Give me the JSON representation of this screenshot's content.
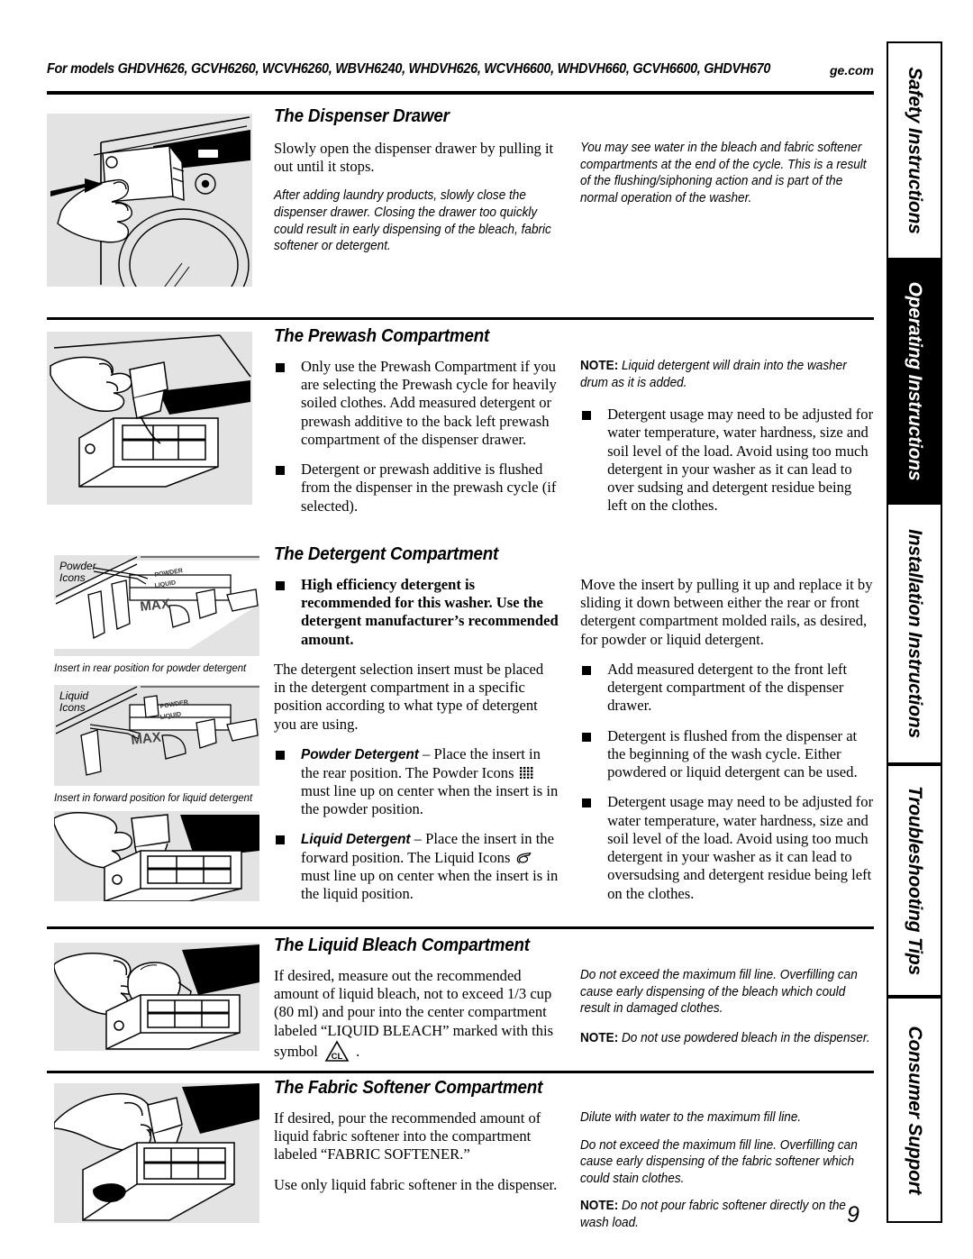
{
  "header": {
    "models": "For models GHDVH626, GCVH6260, WCVH6260, WBVH6240, WHDVH626, WCVH6600, WHDVH660, GCVH6600, GHDVH670",
    "site": "ge.com"
  },
  "page_number": "9",
  "sidebar": {
    "tabs": [
      {
        "label": "Safety Instructions",
        "active": false
      },
      {
        "label": "Operating Instructions",
        "active": true
      },
      {
        "label": "Installation Instructions",
        "active": false
      },
      {
        "label": "Troubleshooting Tips",
        "active": false
      },
      {
        "label": "Consumer Support",
        "active": false
      }
    ]
  },
  "sections": {
    "dispenser_drawer": {
      "title": "The Dispenser Drawer",
      "left_p1": "Slowly open the dispenser drawer by pulling it out until it stops.",
      "left_p2": "After adding laundry products, slowly close the dispenser drawer. Closing the drawer too quickly could result in early dispensing of the bleach, fabric softener or detergent.",
      "right_p1": "You may see water in the bleach and fabric softener compartments at the end of the cycle. This is a result of the flushing/siphoning action and is part of the normal operation of the washer."
    },
    "prewash": {
      "title": "The Prewash Compartment",
      "bullets": [
        "Only use the Prewash Compartment if you are selecting the Prewash cycle for heavily soiled clothes. Add measured detergent or prewash additive to the back left prewash compartment of the dispenser drawer.",
        "Detergent or prewash additive is flushed from the dispenser in the prewash cycle (if selected)."
      ],
      "note_label": "NOTE:",
      "note_text": " Liquid detergent will drain into the washer drum as it is added.",
      "right_bullets": [
        "Detergent usage may need to be adjusted for water temperature, water hardness, size and soil level of the load. Avoid using too much detergent in your washer as it can lead to over sudsing and detergent residue being left on the clothes."
      ]
    },
    "detergent": {
      "title": "The Detergent Compartment",
      "bullet_bold": "High efficiency detergent is recommended for this washer. Use the detergent manufacturer’s recommended amount.",
      "para": "The detergent selection insert must be placed in the detergent compartment in a specific position according to what type of detergent you are using.",
      "powder_lead": "Powder Detergent",
      "powder_text_a": " – Place the insert in the rear position. The Powder Icons ",
      "powder_text_b": " must line up on center when the insert is in the powder position.",
      "liquid_lead": "Liquid Detergent",
      "liquid_text_a": " – Place the insert in the forward position. The Liquid Icons ",
      "liquid_text_b": " must line up on center when the insert is in the liquid position.",
      "right_para": "Move the insert by pulling it up and replace it by sliding it down between either the rear or front detergent compartment molded rails, as desired, for powder or liquid detergent.",
      "right_bullets": [
        "Add measured detergent to the front left detergent compartment of the dispenser drawer.",
        "Detergent is flushed from the dispenser at the beginning of the wash cycle. Either powdered or liquid detergent can be used.",
        "Detergent usage may need to be adjusted for water temperature, water hardness, size and soil level of the load. Avoid using too much detergent in your washer as it can lead to oversudsing and detergent residue being left on the clothes."
      ],
      "caption_powder": "Insert in rear position for powder detergent",
      "caption_liquid": "Insert in forward position for liquid detergent",
      "illus_label_powder": "Powder\nIcons",
      "illus_label_powder_line1": "Powder",
      "illus_label_powder_line2": "Icons",
      "illus_label_liquid_line1": "Liquid",
      "illus_label_liquid_line2": "Icons",
      "illus_max": "MAX",
      "illus_powder_word": "POWDER",
      "illus_liquid_word": "LIQUID"
    },
    "bleach": {
      "title": "The Liquid Bleach Compartment",
      "left_a": "If desired, measure out the recommended amount of liquid bleach, not to exceed 1/3 cup (80 ml) and pour into the center compartment labeled “LIQUID BLEACH” marked with this symbol ",
      "left_b": " .",
      "right_p1": "Do not exceed the maximum fill line. Overfilling can cause early dispensing of the bleach which could result in damaged clothes.",
      "note_label": "NOTE:",
      "note_text": " Do not use powdered bleach in the dispenser.",
      "symbol_text": "CL"
    },
    "softener": {
      "title": "The Fabric Softener Compartment",
      "left_p1": "If desired, pour the recommended amount of liquid fabric softener into the compartment labeled “FABRIC SOFTENER.”",
      "left_p2": "Use only liquid fabric softener in the dispenser.",
      "right_p1": "Dilute with water to the maximum fill line.",
      "right_p2": "Do not exceed the maximum fill line. Overfilling can cause early dispensing of the fabric softener which could stain clothes.",
      "note_label": "NOTE:",
      "note_text": " Do not pour fabric softener directly on the wash load."
    }
  },
  "colors": {
    "ink": "#000000",
    "illustration_bg": "#e3e3e3",
    "paper": "#ffffff"
  }
}
